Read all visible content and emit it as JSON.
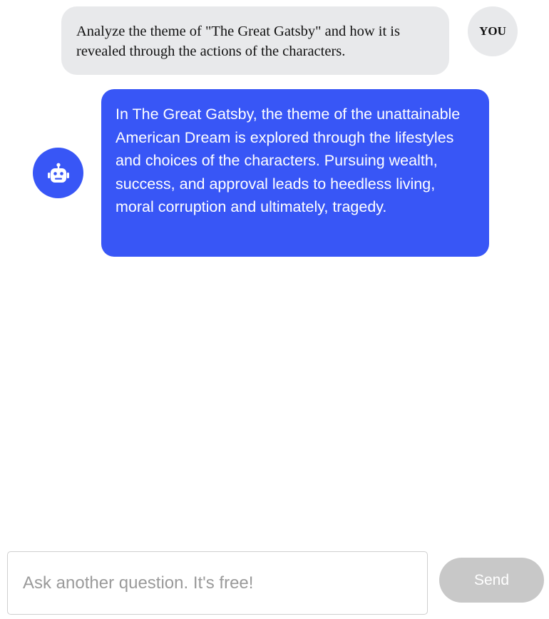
{
  "conversation": {
    "user_message": {
      "text": "Analyze the theme of \"The Great Gatsby\" and how it is revealed through the actions of the characters.",
      "avatar_label": "YOU"
    },
    "bot_message": {
      "text": "In The Great Gatsby, the theme of the unattainable American Dream is explored through the lifestyles and choices of the characters. Pursuing wealth, success, and approval leads to heedless living, moral corruption and ultimately, tragedy.",
      "avatar_icon": "robot-icon"
    }
  },
  "composer": {
    "placeholder": "Ask another question. It's free!",
    "value": "",
    "send_label": "Send"
  },
  "colors": {
    "accent": "#3856f6",
    "user_bubble": "#e8e9eb",
    "send_disabled": "#c8c8c8"
  }
}
